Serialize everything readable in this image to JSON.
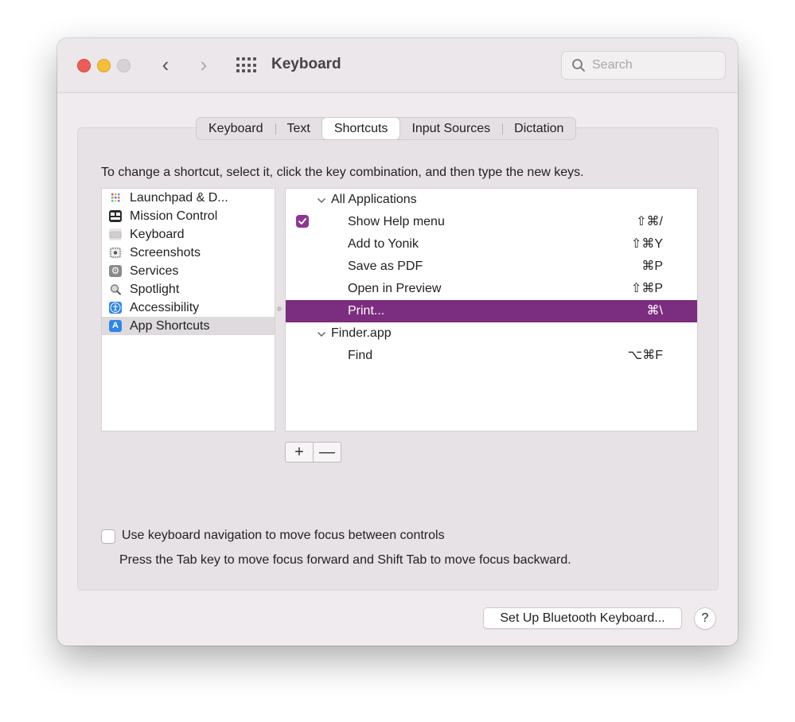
{
  "window": {
    "title": "Keyboard",
    "search_placeholder": "Search"
  },
  "nav": {
    "back_glyph": "‹",
    "forward_glyph": "›"
  },
  "tabs": [
    {
      "label": "Keyboard",
      "active": false
    },
    {
      "label": "Text",
      "active": false
    },
    {
      "label": "Shortcuts",
      "active": true
    },
    {
      "label": "Input Sources",
      "active": false
    },
    {
      "label": "Dictation",
      "active": false
    }
  ],
  "instructions": "To change a shortcut, select it, click the key combination, and then type the new keys.",
  "sidebar": {
    "items": [
      {
        "label": "Launchpad & D...",
        "icon": "launchpad-icon",
        "selected": false
      },
      {
        "label": "Mission Control",
        "icon": "mission-control-icon",
        "selected": false
      },
      {
        "label": "Keyboard",
        "icon": "keyboard-icon",
        "selected": false
      },
      {
        "label": "Screenshots",
        "icon": "screenshots-icon",
        "selected": false
      },
      {
        "label": "Services",
        "icon": "services-gear-icon",
        "selected": false
      },
      {
        "label": "Spotlight",
        "icon": "spotlight-magnifier-icon",
        "selected": false
      },
      {
        "label": "Accessibility",
        "icon": "accessibility-icon",
        "selected": false
      },
      {
        "label": "App Shortcuts",
        "icon": "app-store-icon",
        "selected": true
      }
    ]
  },
  "shortcuts": {
    "groups": [
      {
        "name": "All Applications",
        "items": [
          {
            "label": "Show Help menu",
            "keys": "⇧⌘/",
            "checked": true,
            "selected": false
          },
          {
            "label": "Add to Yonik",
            "keys": "⇧⌘Y",
            "checked": false,
            "selected": false
          },
          {
            "label": "Save as PDF",
            "keys": "⌘P",
            "checked": false,
            "selected": false
          },
          {
            "label": "Open in Preview",
            "keys": "⇧⌘P",
            "checked": false,
            "selected": false
          },
          {
            "label": "Print...",
            "keys": "⌘\\",
            "checked": false,
            "selected": true
          }
        ]
      },
      {
        "name": "Finder.app",
        "items": [
          {
            "label": "Find",
            "keys": "⌥⌘F",
            "checked": false,
            "selected": false
          }
        ]
      }
    ]
  },
  "buttons": {
    "add": "+",
    "remove": "—",
    "bluetooth": "Set Up Bluetooth Keyboard...",
    "help": "?"
  },
  "keyboard_navigation": {
    "label": "Use keyboard navigation to move focus between controls",
    "description": "Press the Tab key to move focus forward and Shift Tab to move focus backward.",
    "checked": false
  },
  "colors": {
    "selection": "#7b2d7f",
    "checkbox": "#8f3596",
    "close": "#ee5c57",
    "minimize": "#f5bf37"
  }
}
